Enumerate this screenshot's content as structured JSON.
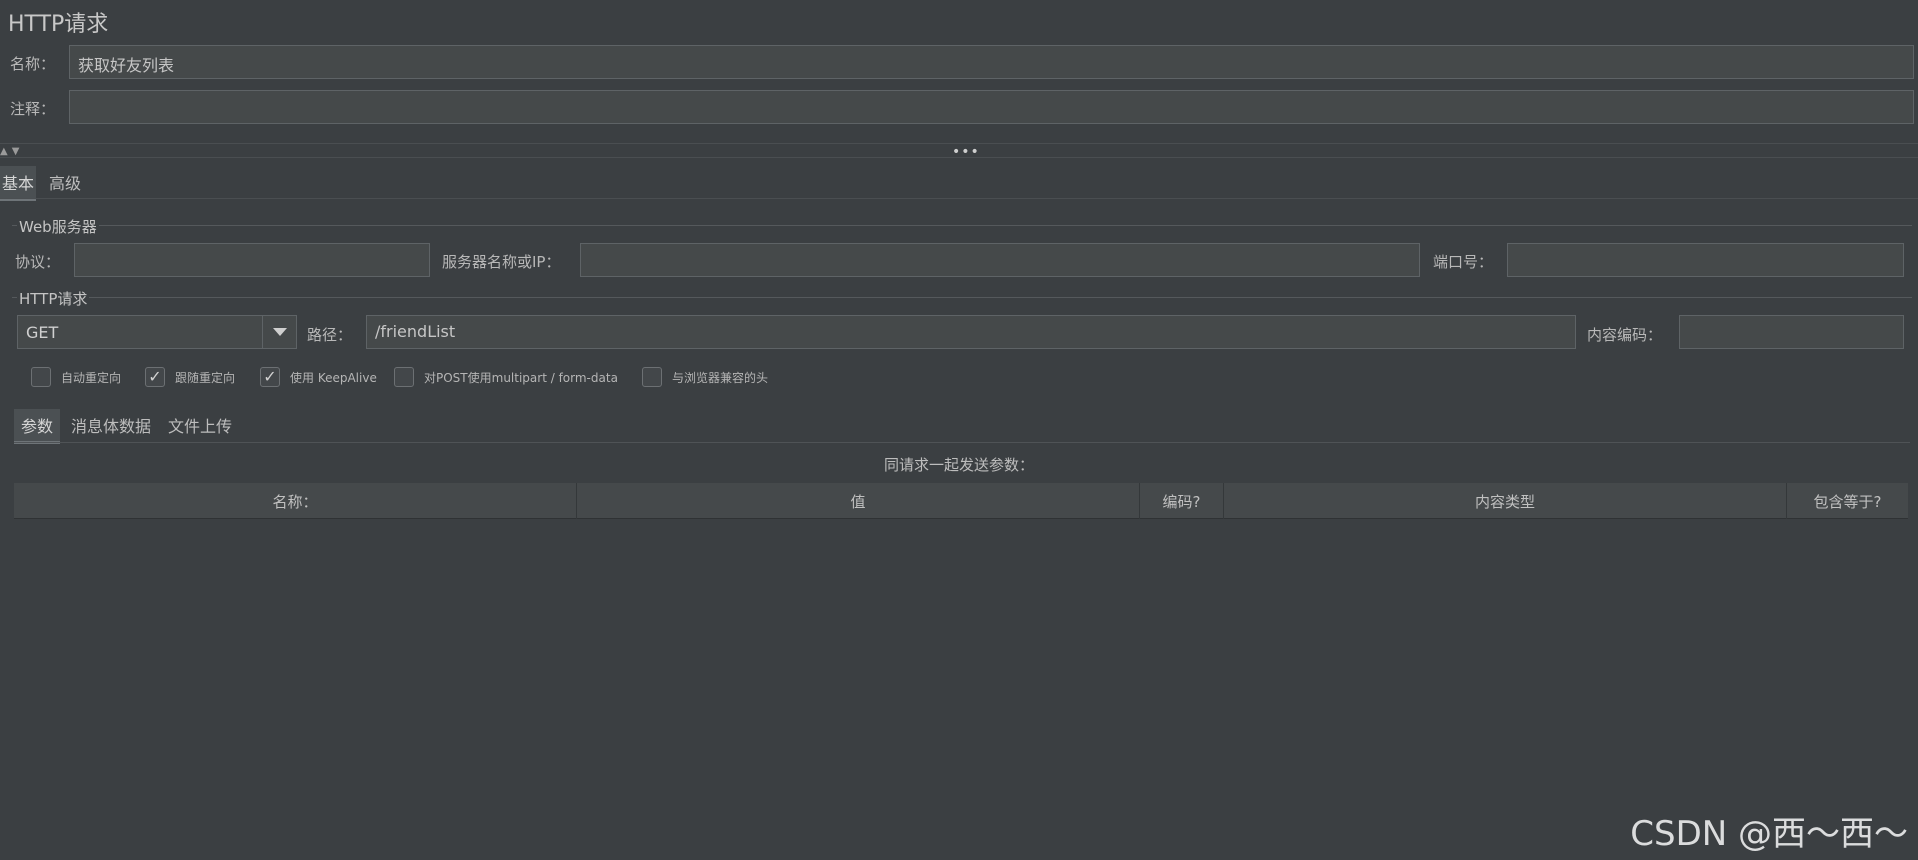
{
  "title": "HTTP请求",
  "name": {
    "label": "名称：",
    "value": "获取好友列表"
  },
  "comment": {
    "label": "注释：",
    "value": ""
  },
  "splitter": {
    "dots": "•••",
    "arrows": "▲▼"
  },
  "tabs": [
    "基本",
    "高级"
  ],
  "web_server": {
    "group_label": "Web服务器",
    "protocol_label": "协议：",
    "protocol_value": "",
    "server_label": "服务器名称或IP：",
    "server_value": "",
    "port_label": "端口号：",
    "port_value": ""
  },
  "http_request": {
    "group_label": "HTTP请求",
    "method": "GET",
    "path_label": "路径：",
    "path_value": "/friendList",
    "encoding_label": "内容编码：",
    "encoding_value": ""
  },
  "options": [
    {
      "label": "自动重定向",
      "checked": false
    },
    {
      "label": "跟随重定向",
      "checked": true
    },
    {
      "label": "使用 KeepAlive",
      "checked": true
    },
    {
      "label": "对POST使用multipart / form-data",
      "checked": false
    },
    {
      "label": "与浏览器兼容的头",
      "checked": false
    }
  ],
  "sub_tabs": [
    "参数",
    "消息体数据",
    "文件上传"
  ],
  "params_caption": "同请求一起发送参数：",
  "table": {
    "columns": [
      "名称：",
      "值",
      "编码?",
      "内容类型",
      "包含等于?"
    ]
  },
  "watermark": "CSDN @西～西～",
  "checkmark": "✓"
}
